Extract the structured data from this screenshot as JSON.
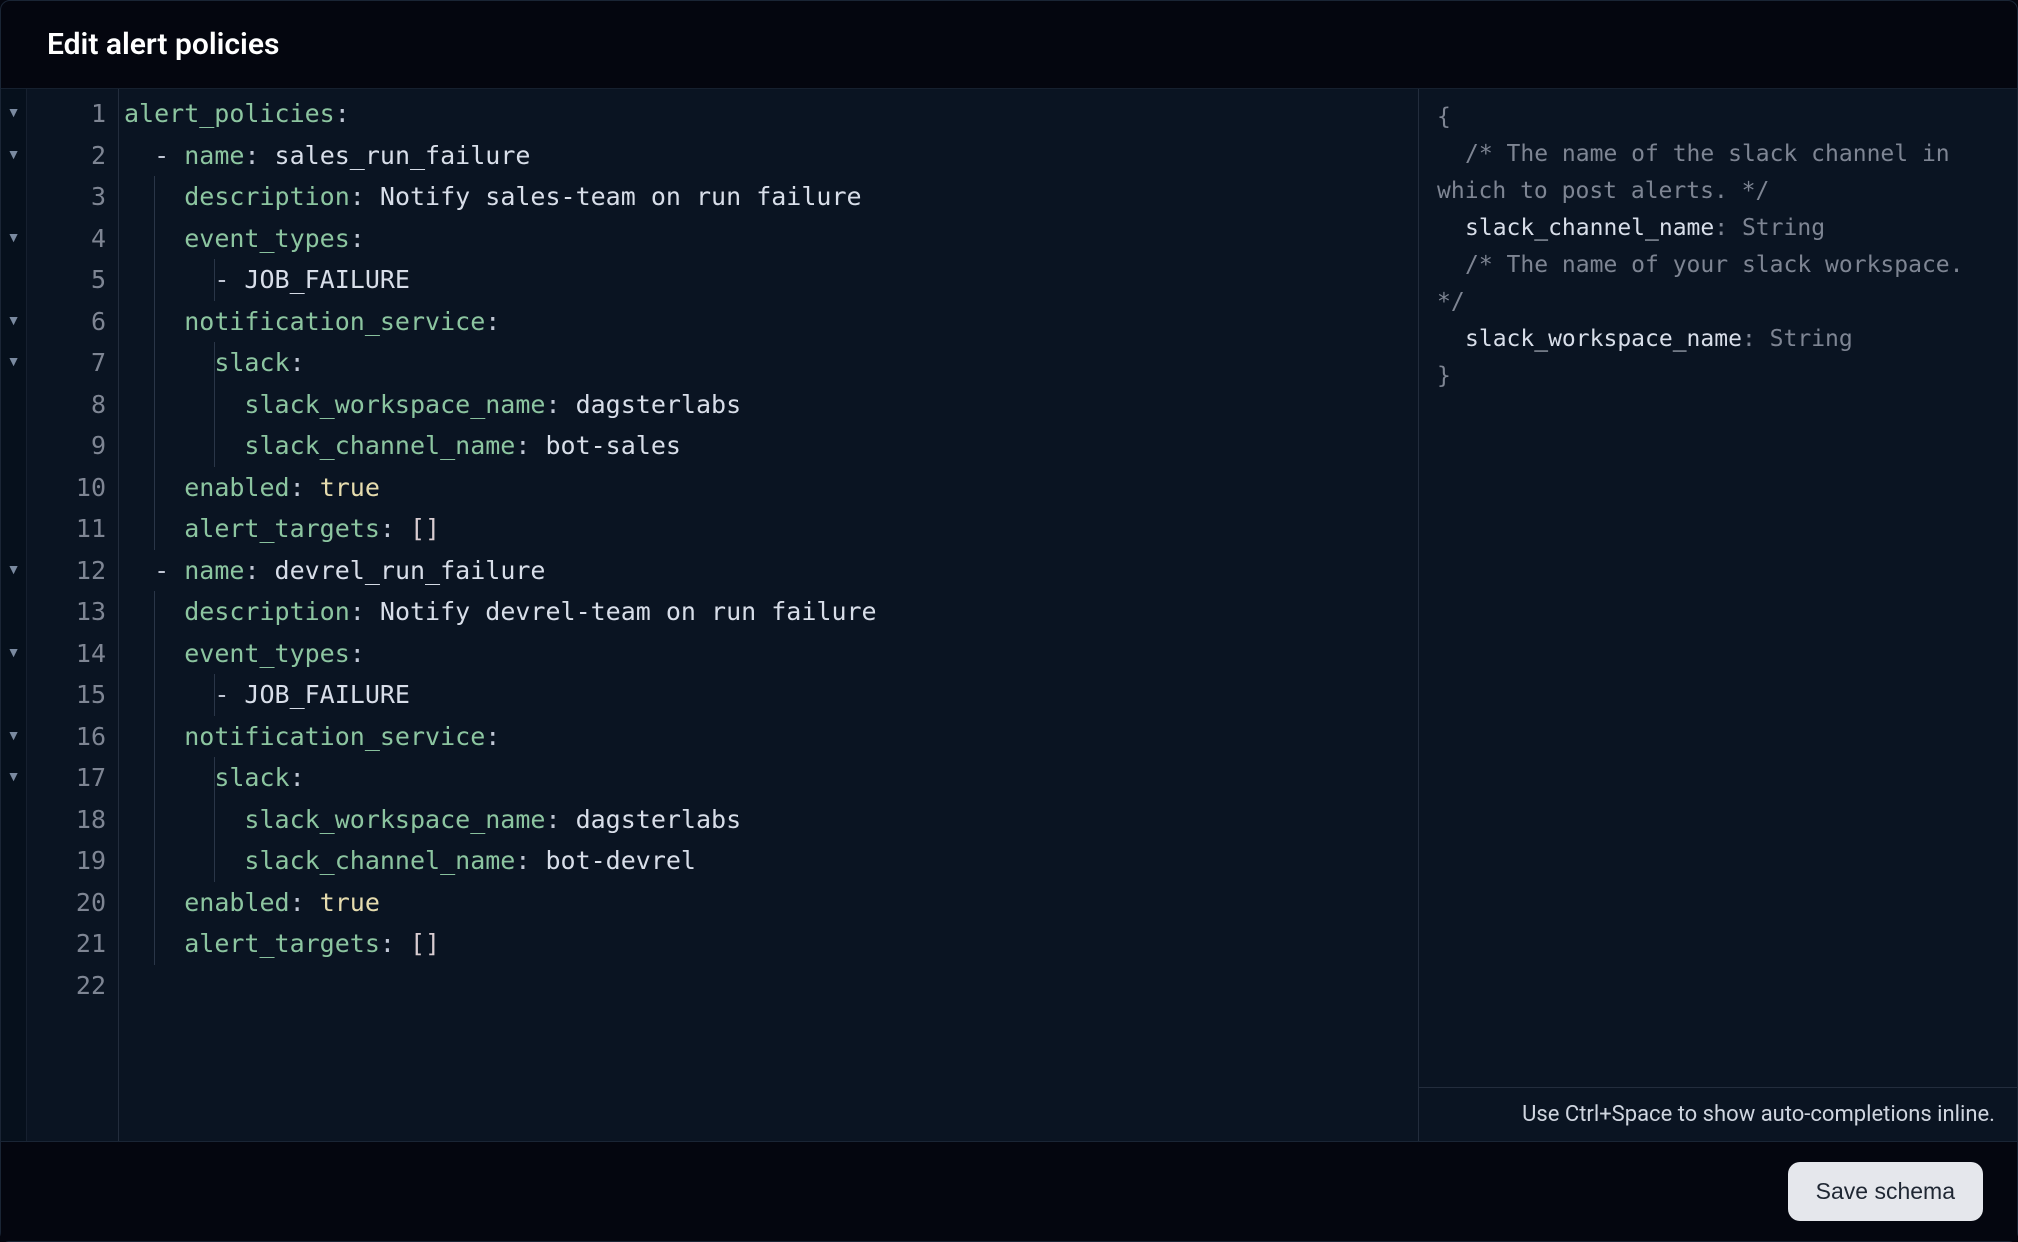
{
  "header": {
    "title": "Edit alert policies"
  },
  "editor": {
    "fold_lines": [
      1,
      2,
      4,
      6,
      7,
      12,
      14,
      16,
      17
    ],
    "line_count": 22,
    "lines": [
      {
        "n": 1,
        "indent": 0,
        "guides": [],
        "tokens": [
          [
            "key",
            "alert_policies"
          ],
          [
            "punc",
            ":"
          ]
        ]
      },
      {
        "n": 2,
        "indent": 2,
        "guides": [],
        "tokens": [
          [
            "dash",
            "- "
          ],
          [
            "key",
            "name"
          ],
          [
            "punc",
            ": "
          ],
          [
            "str",
            "sales_run_failure"
          ]
        ]
      },
      {
        "n": 3,
        "indent": 4,
        "guides": [
          1
        ],
        "tokens": [
          [
            "key",
            "description"
          ],
          [
            "punc",
            ": "
          ],
          [
            "str",
            "Notify sales-team on run failure"
          ]
        ]
      },
      {
        "n": 4,
        "indent": 4,
        "guides": [
          1
        ],
        "tokens": [
          [
            "key",
            "event_types"
          ],
          [
            "punc",
            ":"
          ]
        ]
      },
      {
        "n": 5,
        "indent": 6,
        "guides": [
          1,
          2
        ],
        "tokens": [
          [
            "dash",
            "- "
          ],
          [
            "str",
            "JOB_FAILURE"
          ]
        ]
      },
      {
        "n": 6,
        "indent": 4,
        "guides": [
          1
        ],
        "tokens": [
          [
            "key",
            "notification_service"
          ],
          [
            "punc",
            ":"
          ]
        ]
      },
      {
        "n": 7,
        "indent": 6,
        "guides": [
          1,
          2
        ],
        "tokens": [
          [
            "key",
            "slack"
          ],
          [
            "punc",
            ":"
          ]
        ]
      },
      {
        "n": 8,
        "indent": 8,
        "guides": [
          1,
          2
        ],
        "tokens": [
          [
            "key",
            "slack_workspace_name"
          ],
          [
            "punc",
            ": "
          ],
          [
            "str",
            "dagsterlabs"
          ]
        ]
      },
      {
        "n": 9,
        "indent": 8,
        "guides": [
          1,
          2
        ],
        "tokens": [
          [
            "key",
            "slack_channel_name"
          ],
          [
            "punc",
            ": "
          ],
          [
            "str",
            "bot-sales"
          ]
        ]
      },
      {
        "n": 10,
        "indent": 4,
        "guides": [
          1
        ],
        "tokens": [
          [
            "key",
            "enabled"
          ],
          [
            "punc",
            ": "
          ],
          [
            "bool",
            "true"
          ]
        ]
      },
      {
        "n": 11,
        "indent": 4,
        "guides": [
          1
        ],
        "tokens": [
          [
            "key",
            "alert_targets"
          ],
          [
            "punc",
            ": "
          ],
          [
            "brack",
            "[]"
          ]
        ]
      },
      {
        "n": 12,
        "indent": 2,
        "guides": [],
        "tokens": [
          [
            "dash",
            "- "
          ],
          [
            "key",
            "name"
          ],
          [
            "punc",
            ": "
          ],
          [
            "str",
            "devrel_run_failure"
          ]
        ]
      },
      {
        "n": 13,
        "indent": 4,
        "guides": [
          1
        ],
        "tokens": [
          [
            "key",
            "description"
          ],
          [
            "punc",
            ": "
          ],
          [
            "str",
            "Notify devrel-team on run failure"
          ]
        ]
      },
      {
        "n": 14,
        "indent": 4,
        "guides": [
          1
        ],
        "tokens": [
          [
            "key",
            "event_types"
          ],
          [
            "punc",
            ":"
          ]
        ]
      },
      {
        "n": 15,
        "indent": 6,
        "guides": [
          1,
          2
        ],
        "tokens": [
          [
            "dash",
            "- "
          ],
          [
            "str",
            "JOB_FAILURE"
          ]
        ]
      },
      {
        "n": 16,
        "indent": 4,
        "guides": [
          1
        ],
        "tokens": [
          [
            "key",
            "notification_service"
          ],
          [
            "punc",
            ":"
          ]
        ]
      },
      {
        "n": 17,
        "indent": 6,
        "guides": [
          1,
          2
        ],
        "tokens": [
          [
            "key",
            "slack"
          ],
          [
            "punc",
            ":"
          ]
        ]
      },
      {
        "n": 18,
        "indent": 8,
        "guides": [
          1,
          2
        ],
        "tokens": [
          [
            "key",
            "slack_workspace_name"
          ],
          [
            "punc",
            ": "
          ],
          [
            "str",
            "dagsterlabs"
          ]
        ]
      },
      {
        "n": 19,
        "indent": 8,
        "guides": [
          1,
          2
        ],
        "tokens": [
          [
            "key",
            "slack_channel_name"
          ],
          [
            "punc",
            ": "
          ],
          [
            "str",
            "bot-devrel"
          ]
        ]
      },
      {
        "n": 20,
        "indent": 4,
        "guides": [
          1
        ],
        "tokens": [
          [
            "key",
            "enabled"
          ],
          [
            "punc",
            ": "
          ],
          [
            "bool",
            "true"
          ]
        ]
      },
      {
        "n": 21,
        "indent": 4,
        "guides": [
          1
        ],
        "tokens": [
          [
            "key",
            "alert_targets"
          ],
          [
            "punc",
            ": "
          ],
          [
            "brack",
            "[]"
          ]
        ]
      },
      {
        "n": 22,
        "indent": 0,
        "guides": [],
        "tokens": []
      }
    ]
  },
  "schema": {
    "open": "{",
    "comment1": "/* The name of the slack channel in which to post alerts. */",
    "key1": "slack_channel_name",
    "type1": "String",
    "comment2": "/* The name of your slack workspace. */",
    "key2": "slack_workspace_name",
    "type2": "String",
    "close": "}",
    "hint": "Use Ctrl+Space to show auto-completions inline."
  },
  "footer": {
    "save_label": "Save schema"
  }
}
